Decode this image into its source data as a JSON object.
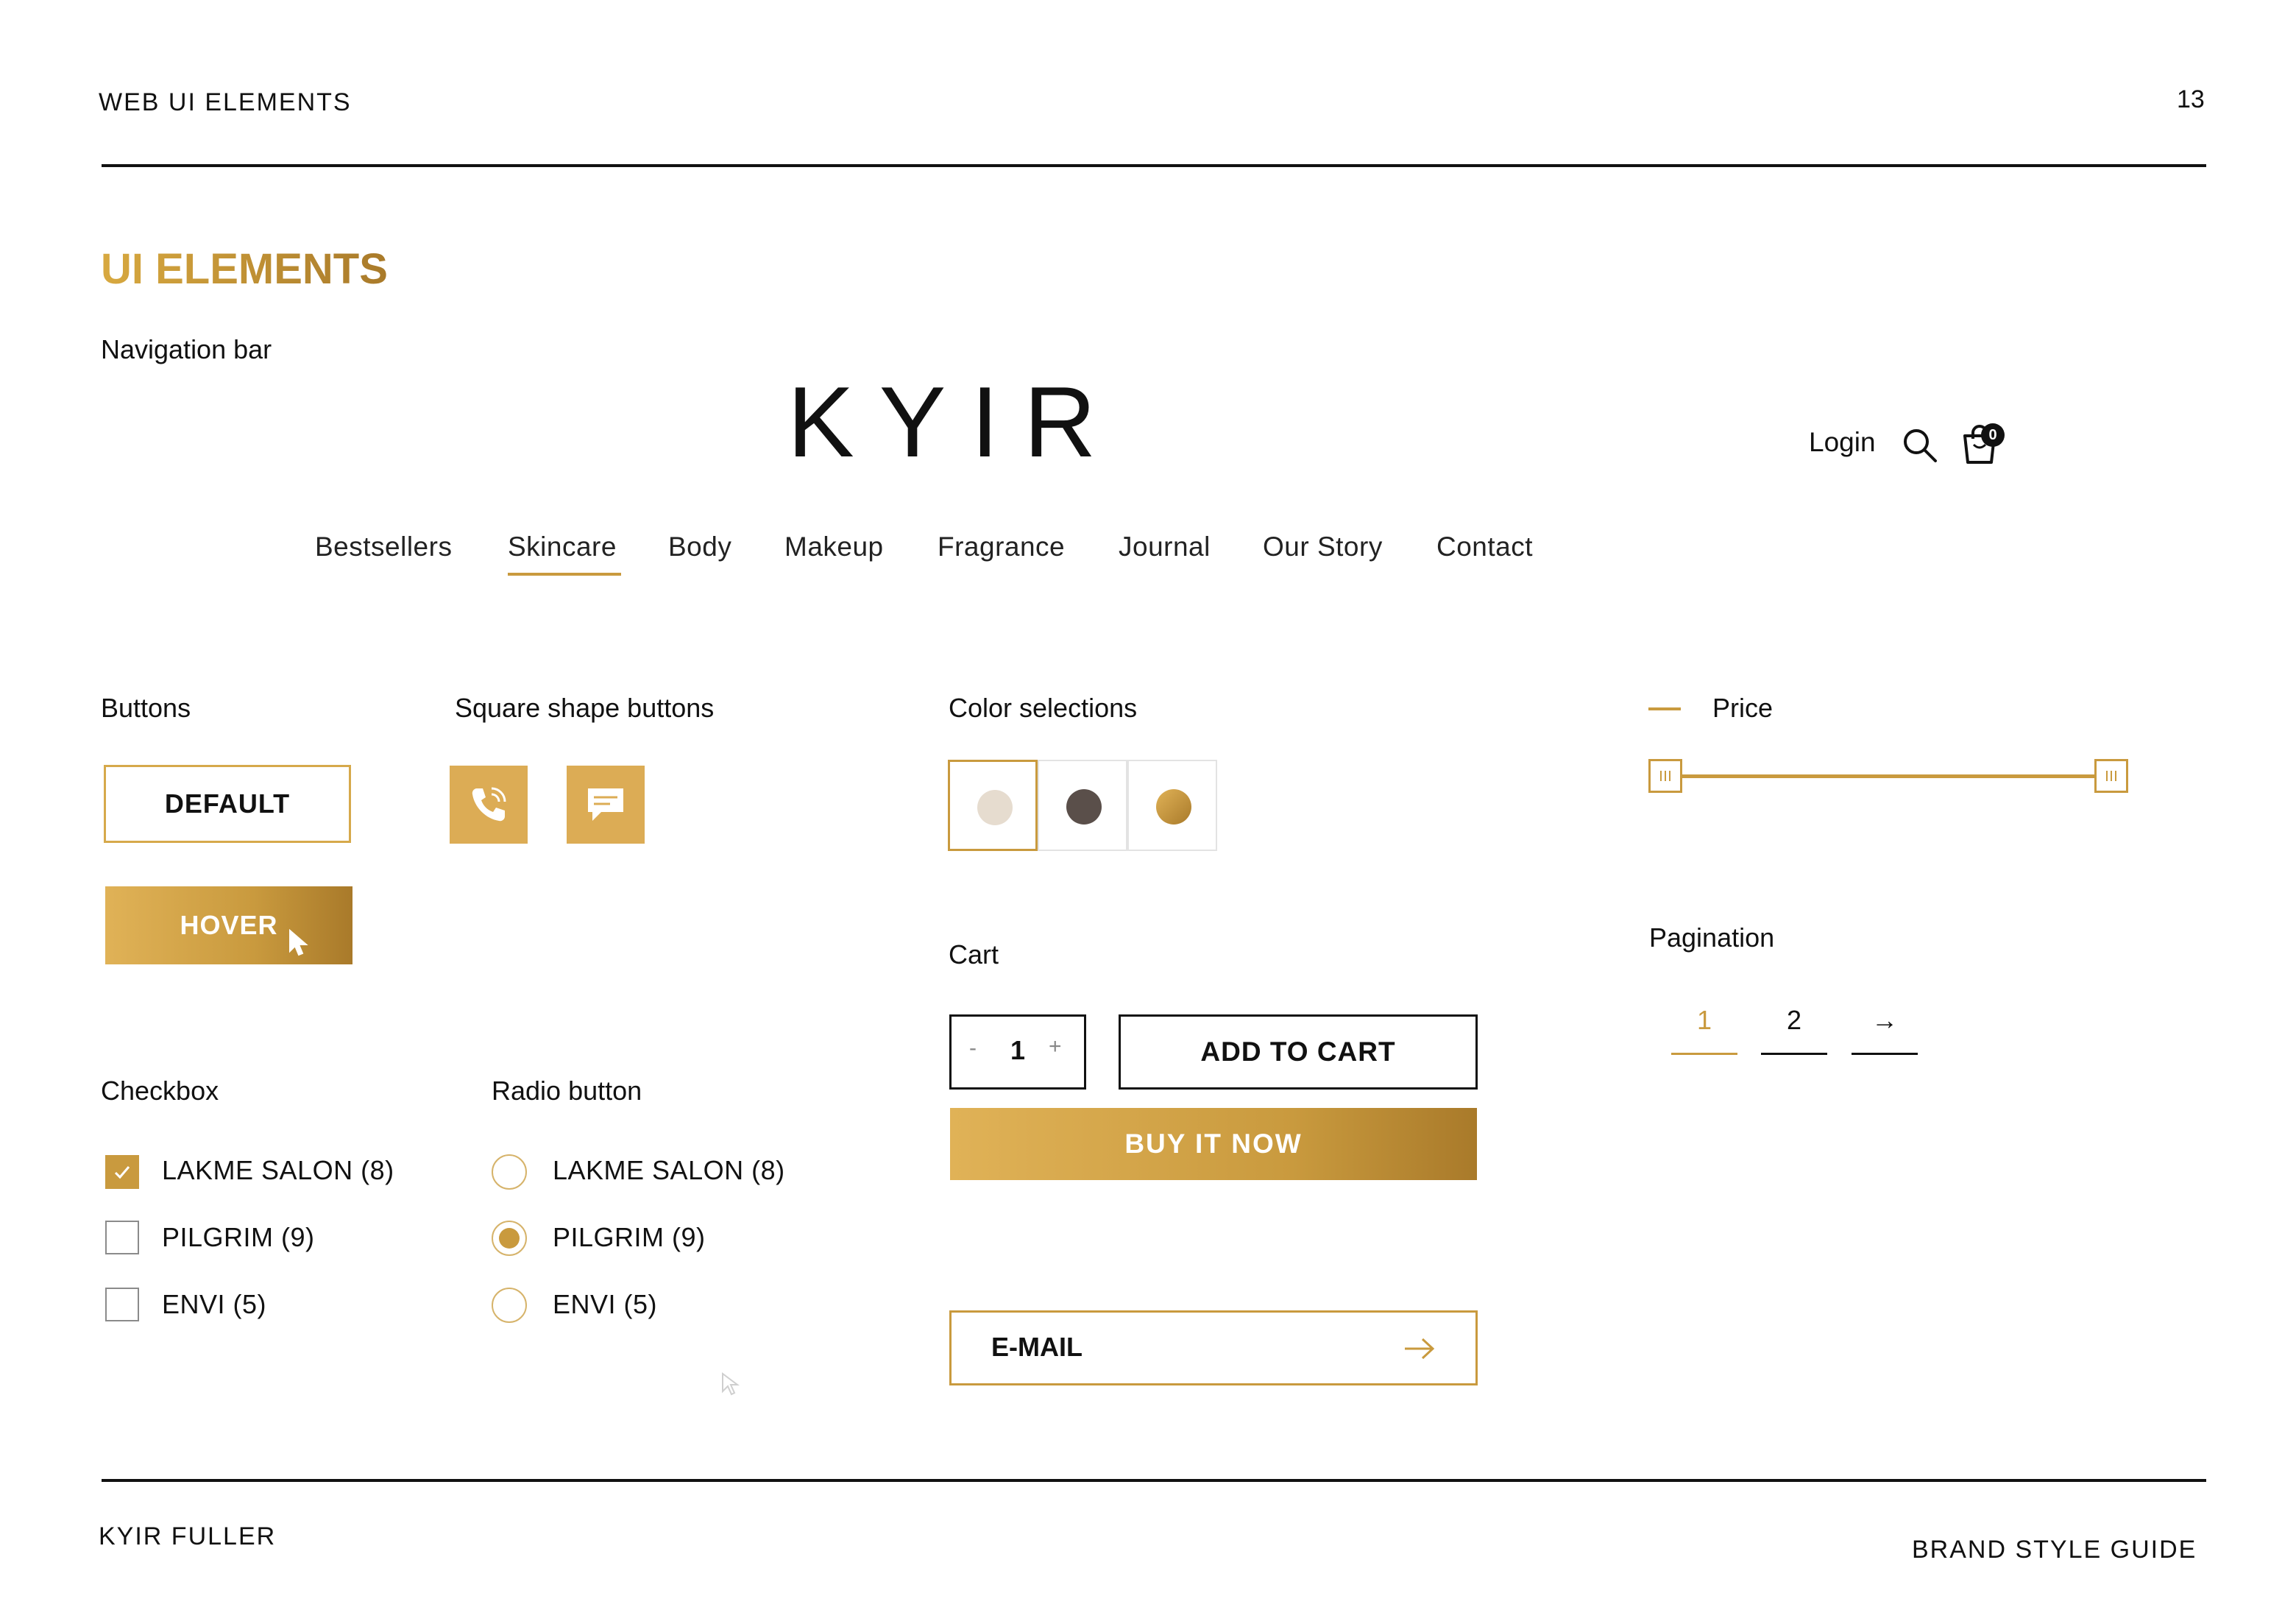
{
  "page": {
    "header_left": "WEB UI ELEMENTS",
    "page_number": "13",
    "footer_left": "KYIR FULLER",
    "footer_right": "BRAND STYLE GUIDE"
  },
  "colors": {
    "gold": "#c99a3e",
    "gold_light": "#e0b257",
    "gold_dark": "#a97a2a",
    "swatch_cream": "#e6dccf",
    "swatch_dark": "#5a4f4a",
    "swatch_gold": "#c99a3e"
  },
  "section_title": "UI ELEMENTS",
  "nav_section": {
    "label": "Navigation bar",
    "logo": "KYIR",
    "login": "Login",
    "cart_count": "0",
    "icons": [
      "search-icon",
      "cart-icon"
    ],
    "items": [
      "Bestsellers",
      "Skincare",
      "Body",
      "Makeup",
      "Fragrance",
      "Journal",
      "Our Story",
      "Contact"
    ],
    "active_item": "Skincare"
  },
  "buttons": {
    "label": "Buttons",
    "default_label": "DEFAULT",
    "hover_label": "HOVER"
  },
  "square_buttons": {
    "label": "Square shape buttons",
    "icons": [
      "phone-icon",
      "chat-icon"
    ]
  },
  "color_selections": {
    "label": "Color selections",
    "selected_index": 0
  },
  "price": {
    "label": "Price",
    "range_fraction": [
      0.0,
      1.0
    ]
  },
  "cart": {
    "label": "Cart",
    "minus": "-",
    "quantity": "1",
    "plus": "+",
    "add_to_cart": "ADD TO CART",
    "buy_now": "BUY IT NOW",
    "email_placeholder": "E-MAIL"
  },
  "pagination": {
    "label": "Pagination",
    "pages": [
      "1",
      "2"
    ],
    "next": "→",
    "current": "1"
  },
  "checkbox": {
    "label": "Checkbox",
    "options": [
      {
        "label": "LAKME SALON (8)",
        "checked": true
      },
      {
        "label": "PILGRIM (9)",
        "checked": false
      },
      {
        "label": "ENVI (5)",
        "checked": false
      }
    ]
  },
  "radio": {
    "label": "Radio button",
    "options": [
      {
        "label": "LAKME SALON (8)",
        "selected": false
      },
      {
        "label": "PILGRIM (9)",
        "selected": true
      },
      {
        "label": "ENVI (5)",
        "selected": false
      }
    ]
  }
}
